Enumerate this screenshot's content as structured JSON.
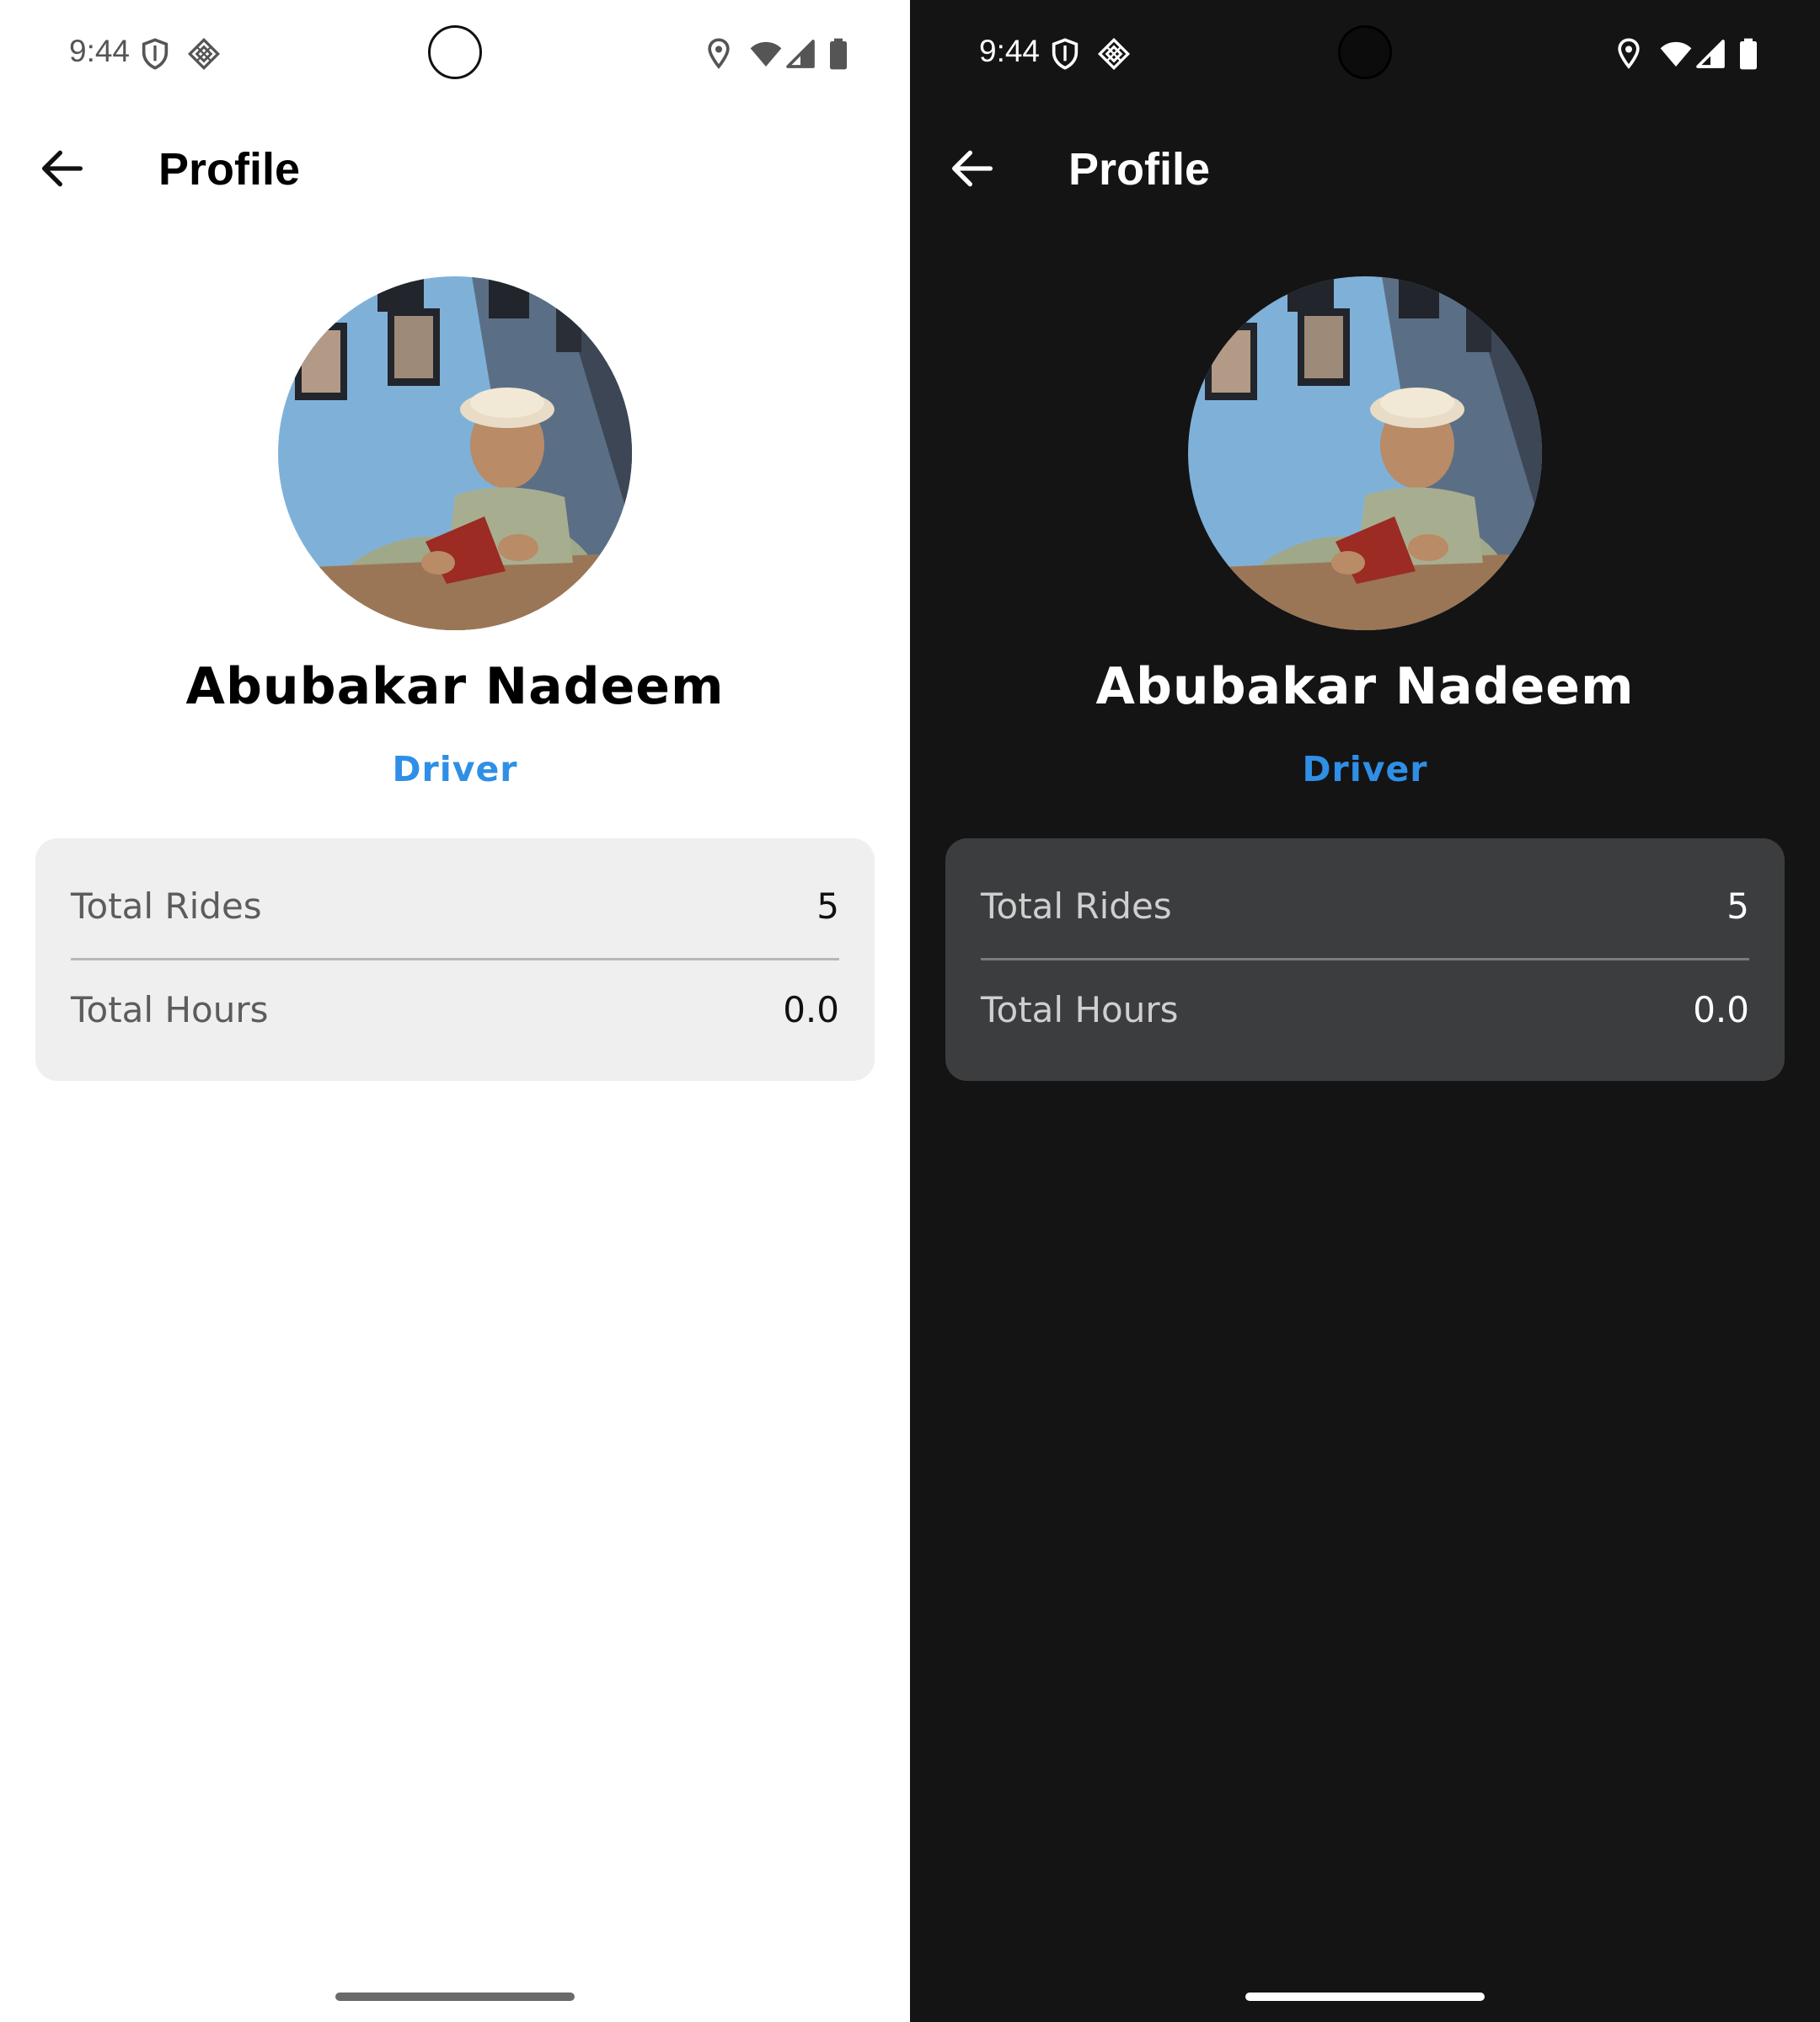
{
  "status_bar": {
    "time": "9:44",
    "icons": [
      "shield-icon",
      "diamond-grid-icon",
      "location-pin-icon",
      "wifi-icon",
      "cell-signal-icon",
      "battery-icon"
    ]
  },
  "app_bar": {
    "title": "Profile",
    "back_icon": "arrow-left-icon"
  },
  "profile": {
    "name": "Abubakar Nadeem",
    "role": "Driver",
    "avatar": "profile-photo"
  },
  "stats": [
    {
      "label": "Total Rides",
      "value": "5"
    },
    {
      "label": "Total Hours",
      "value": "0.0"
    }
  ],
  "colors": {
    "accent": "#2f8fe6",
    "light_background": "#ffffff",
    "dark_background": "#141414",
    "light_card": "#efefef",
    "dark_card": "#3c3d3f"
  }
}
